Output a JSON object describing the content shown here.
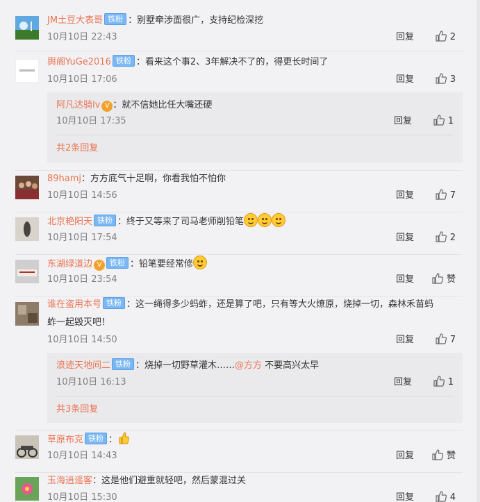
{
  "comments": [
    {
      "user": "JM土豆大表哥",
      "badge": "铁粉",
      "text": "：别墅牵涉面很广，支持纪检深挖",
      "time": "10月10日 22:43",
      "reply": "回复",
      "likes": "2"
    },
    {
      "user": "舆阁YuGe2016",
      "badge": "铁粉",
      "text": "：看来这个事2、3年解决不了的，得更长时间了",
      "time": "10月10日 17:06",
      "reply": "回复",
      "likes": "3",
      "sub": {
        "user": "阿凡达骑lv",
        "text": "：就不信她比任大嘴还硬",
        "time": "10月10日 17:35",
        "reply": "回复",
        "likes": "1",
        "more": "共2条回复"
      }
    },
    {
      "user": "89hamj",
      "text": "：方方底气十足啊，你看我怕不怕你",
      "time": "10月10日 14:56",
      "reply": "回复",
      "likes": "7"
    },
    {
      "user": "北京艳阳天",
      "badge": "铁粉",
      "text": "：终于又等来了司马老师削铅笔",
      "time": "10月10日 17:54",
      "reply": "回复",
      "likes": "2"
    },
    {
      "user": "东湖绿道边",
      "badge": "铁粉",
      "text": "：铅笔要经常修",
      "time": "10月10日 23:54",
      "reply": "回复",
      "likes": "赞"
    },
    {
      "user": "谁在盗用本号",
      "badge": "铁粉",
      "text": "：这一绳得多少蚂蚱，还是算了吧，只有等大火燎原，烧掉一切，森林禾苗蚂",
      "text2": "蚱一起毁灭吧！",
      "time": "10月10日 14:50",
      "reply": "回复",
      "likes": "7",
      "sub": {
        "user": "浪迹天地间二",
        "badge": "铁粉",
        "text": "：烧掉一切野草灌木……",
        "at": "@方方",
        "text_after": " 不要高兴太早",
        "time": "10月10日 16:13",
        "reply": "回复",
        "likes": "1",
        "more": "共3条回复"
      }
    },
    {
      "user": "草原布克",
      "badge": "铁粉",
      "text": "：",
      "time": "10月10日 14:43",
      "reply": "回复",
      "likes": "赞"
    },
    {
      "user": "玉海逍遥客",
      "text": "：这是他们避重就轻吧，然后蒙混过关",
      "time": "10月10日 15:30",
      "reply": "回复",
      "likes": "4"
    }
  ],
  "colors": {
    "username": "#eb7350",
    "badge": "#79b7f5",
    "background": "#f2f2f5"
  },
  "icons": {
    "like": "thumb-up-icon",
    "vip": "vip-level-icon",
    "emoji": "face-emoji-icon"
  }
}
